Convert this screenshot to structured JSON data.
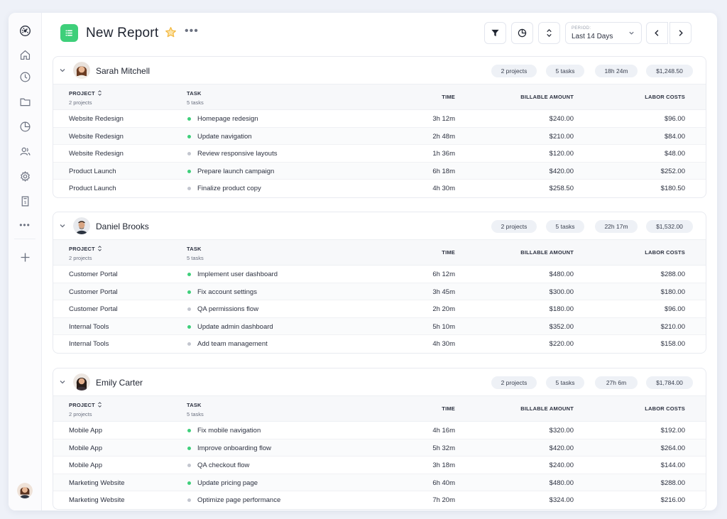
{
  "app": {
    "title": "New Report",
    "more_label": "•••",
    "period_label": "PERIOD:",
    "period_value": "Last 14 Days"
  },
  "colors": {
    "accent_green": "#3ecf7a",
    "status_done": "#3ecf7a",
    "status_pending": "#c3c6cf",
    "star": "#f4b942"
  },
  "sidebar": {
    "items": [
      {
        "icon": "dashboard-icon"
      },
      {
        "icon": "home-icon"
      },
      {
        "icon": "clock-icon"
      },
      {
        "icon": "folder-icon"
      },
      {
        "icon": "pie-chart-icon"
      },
      {
        "icon": "users-icon"
      },
      {
        "icon": "gear-icon"
      },
      {
        "icon": "invoice-icon"
      },
      {
        "icon": "more-icon"
      },
      {
        "icon": "plus-icon"
      }
    ]
  },
  "columns": {
    "project": "PROJECT",
    "task": "TASK",
    "time": "TIME",
    "billable": "BILLABLE AMOUNT",
    "labor": "LABOR COSTS"
  },
  "groups": [
    {
      "name": "Sarah Mitchell",
      "projects_pill": "2 projects",
      "tasks_pill": "5 tasks",
      "time_pill": "18h 24m",
      "amount_pill": "$1,248.50",
      "projects_sub": "2 projects",
      "tasks_sub": "5 tasks",
      "rows": [
        {
          "project": "Website Redesign",
          "task": "Homepage redesign",
          "status": "done",
          "time": "3h 12m",
          "billable": "$240.00",
          "labor": "$96.00"
        },
        {
          "project": "Website Redesign",
          "task": "Update navigation",
          "status": "done",
          "time": "2h 48m",
          "billable": "$210.00",
          "labor": "$84.00"
        },
        {
          "project": "Website Redesign",
          "task": "Review responsive layouts",
          "status": "pending",
          "time": "1h 36m",
          "billable": "$120.00",
          "labor": "$48.00"
        },
        {
          "project": "Product Launch",
          "task": "Prepare launch campaign",
          "status": "done",
          "time": "6h 18m",
          "billable": "$420.00",
          "labor": "$252.00"
        },
        {
          "project": "Product Launch",
          "task": "Finalize product copy",
          "status": "pending",
          "time": "4h 30m",
          "billable": "$258.50",
          "labor": "$180.50"
        }
      ]
    },
    {
      "name": "Daniel Brooks",
      "projects_pill": "2 projects",
      "tasks_pill": "5 tasks",
      "time_pill": "22h 17m",
      "amount_pill": "$1,532.00",
      "projects_sub": "2 projects",
      "tasks_sub": "5 tasks",
      "rows": [
        {
          "project": "Customer Portal",
          "task": "Implement user dashboard",
          "status": "done",
          "time": "6h 12m",
          "billable": "$480.00",
          "labor": "$288.00"
        },
        {
          "project": "Customer Portal",
          "task": "Fix account settings",
          "status": "done",
          "time": "3h 45m",
          "billable": "$300.00",
          "labor": "$180.00"
        },
        {
          "project": "Customer Portal",
          "task": "QA permissions flow",
          "status": "pending",
          "time": "2h 20m",
          "billable": "$180.00",
          "labor": "$96.00"
        },
        {
          "project": "Internal Tools",
          "task": "Update admin dashboard",
          "status": "done",
          "time": "5h 10m",
          "billable": "$352.00",
          "labor": "$210.00"
        },
        {
          "project": "Internal Tools",
          "task": "Add team management",
          "status": "pending",
          "time": "4h 30m",
          "billable": "$220.00",
          "labor": "$158.00"
        }
      ]
    },
    {
      "name": "Emily Carter",
      "projects_pill": "2 projects",
      "tasks_pill": "5 tasks",
      "time_pill": "27h 6m",
      "amount_pill": "$1,784.00",
      "projects_sub": "2 projects",
      "tasks_sub": "5 tasks",
      "rows": [
        {
          "project": "Mobile App",
          "task": "Fix mobile navigation",
          "status": "done",
          "time": "4h 16m",
          "billable": "$320.00",
          "labor": "$192.00"
        },
        {
          "project": "Mobile App",
          "task": "Improve onboarding flow",
          "status": "done",
          "time": "5h 32m",
          "billable": "$420.00",
          "labor": "$264.00"
        },
        {
          "project": "Mobile App",
          "task": "QA checkout flow",
          "status": "pending",
          "time": "3h 18m",
          "billable": "$240.00",
          "labor": "$144.00"
        },
        {
          "project": "Marketing Website",
          "task": "Update pricing page",
          "status": "done",
          "time": "6h 40m",
          "billable": "$480.00",
          "labor": "$288.00"
        },
        {
          "project": "Marketing Website",
          "task": "Optimize page performance",
          "status": "pending",
          "time": "7h 20m",
          "billable": "$324.00",
          "labor": "$216.00"
        }
      ]
    }
  ]
}
